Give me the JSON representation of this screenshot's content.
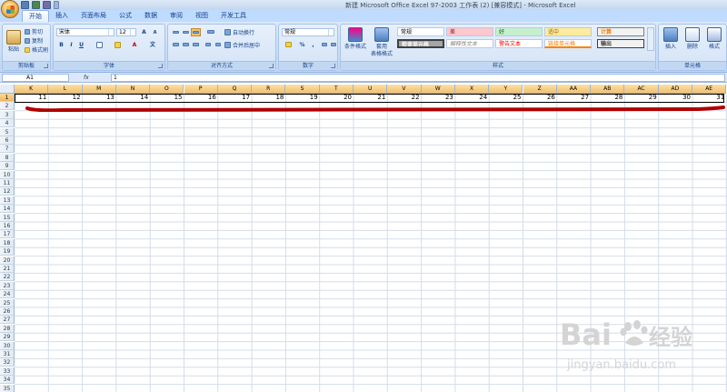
{
  "title_bar": {
    "title": "新建 Microsoft Office Excel 97-2003 工作表 (2)  [兼容模式] - Microsoft Excel"
  },
  "tabs": [
    "开始",
    "插入",
    "页面布局",
    "公式",
    "数据",
    "审阅",
    "视图",
    "开发工具"
  ],
  "active_tab": "开始",
  "ribbon": {
    "clipboard": {
      "paste": "粘贴",
      "cut": "剪切",
      "copy": "复制",
      "format_painter": "格式刷",
      "label": "剪贴板"
    },
    "font": {
      "name": "宋体",
      "size": "12",
      "bold": "B",
      "italic": "I",
      "underline": "U",
      "grow": "A",
      "shrink": "A",
      "font_color_letter": "A",
      "phonetic": "文",
      "label": "字体"
    },
    "alignment": {
      "wrap_text": "自动换行",
      "merge_center": "合并后居中",
      "label": "对齐方式"
    },
    "number": {
      "format": "常规",
      "percent": "%",
      "comma": ",",
      "label": "数字"
    },
    "styles": {
      "conditional_format": "条件格式",
      "table_format_1": "套用",
      "table_format_2": "表格格式",
      "gallery": [
        [
          "常规",
          "差",
          "好",
          "适中",
          "计算"
        ],
        [
          "检查单元格",
          "解释性文本",
          "警告文本",
          "链接单元格",
          "输出"
        ]
      ],
      "label": "样式"
    },
    "cells": {
      "insert": "插入",
      "delete": "删除",
      "format": "格式",
      "label": "单元格"
    }
  },
  "formula_bar": {
    "name_box": "A1",
    "fx": "fx",
    "content": "1"
  },
  "sheet": {
    "columns": [
      "K",
      "L",
      "M",
      "N",
      "O",
      "P",
      "Q",
      "R",
      "S",
      "T",
      "U",
      "V",
      "W",
      "X",
      "Y",
      "Z",
      "AA",
      "AB",
      "AC",
      "AD",
      "AE"
    ],
    "row_numbers": [
      "1",
      "2",
      "3",
      "4",
      "5",
      "6",
      "7",
      "8",
      "9",
      "10",
      "11",
      "12",
      "13",
      "14",
      "15",
      "16",
      "17",
      "18",
      "19",
      "20",
      "21",
      "22",
      "23",
      "24",
      "25",
      "26",
      "27",
      "28",
      "29",
      "30",
      "31",
      "32",
      "33",
      "34",
      "35"
    ],
    "row1_values": [
      "11",
      "12",
      "13",
      "14",
      "15",
      "16",
      "17",
      "18",
      "19",
      "20",
      "21",
      "22",
      "23",
      "24",
      "25",
      "26",
      "27",
      "28",
      "29",
      "30",
      "31"
    ]
  },
  "watermark": {
    "brand": "Bai",
    "brand2": "经验",
    "url": "jingyan.baidu.com"
  },
  "colors": {
    "title_bg": "#c4d6ee",
    "ribbon_bg": "#c7dbf4",
    "selected_header": "#f4c06c",
    "annotation_red": "#b00000"
  }
}
